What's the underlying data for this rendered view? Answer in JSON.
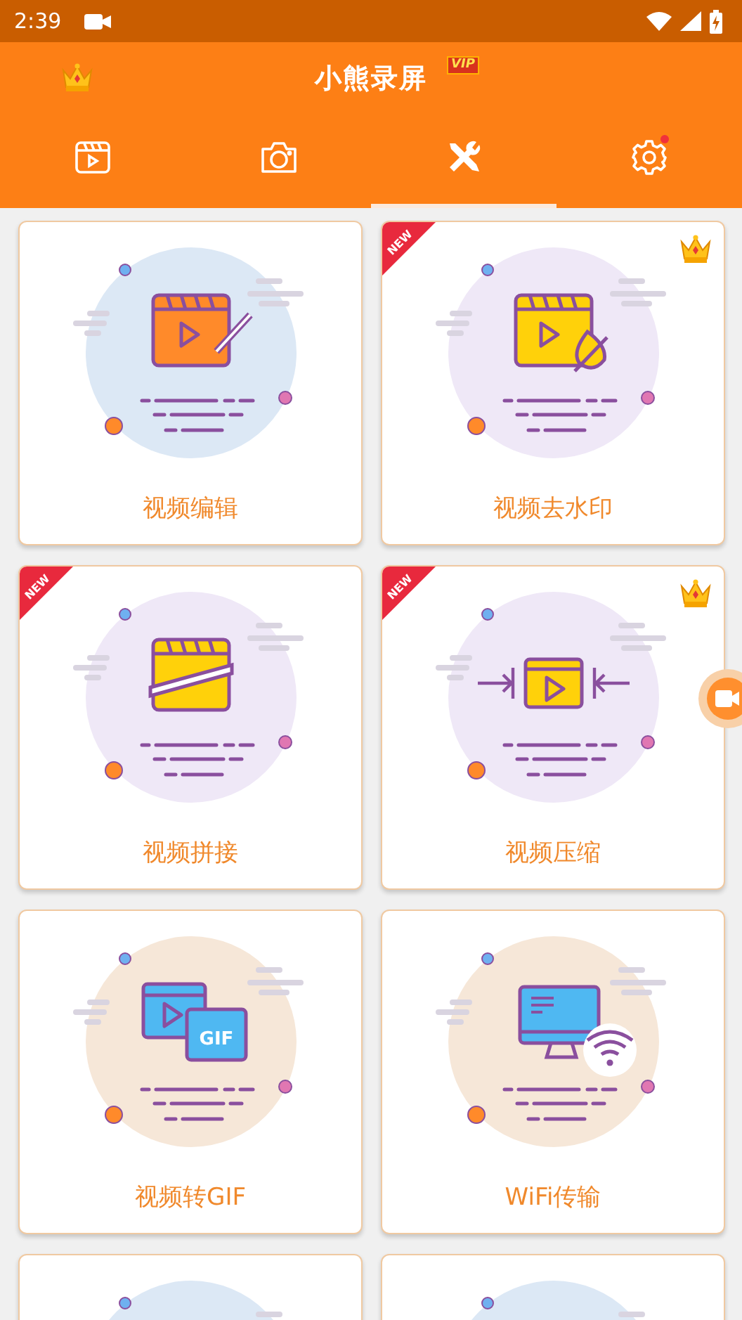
{
  "status_bar": {
    "time": "2:39"
  },
  "header": {
    "title": "小熊录屏",
    "vip_badge": "VIP"
  },
  "tabs": [
    {
      "kind": "clapper",
      "selected": false,
      "dot": false
    },
    {
      "kind": "camera",
      "selected": false,
      "dot": false
    },
    {
      "kind": "tools",
      "selected": true,
      "dot": false
    },
    {
      "kind": "settings",
      "selected": false,
      "dot": true
    }
  ],
  "cards": [
    {
      "kind": "edit",
      "label": "视频编辑",
      "color": "#dce8f5",
      "vip": false
    },
    {
      "kind": "watermark",
      "label": "视频去水印",
      "color": "#efe8f7",
      "new_badge": "NEW",
      "vip": true
    },
    {
      "kind": "splice",
      "label": "视频拼接",
      "color": "#efe8f7",
      "new_badge": "NEW",
      "vip": false
    },
    {
      "kind": "compress",
      "label": "视频压缩",
      "color": "#efe8f7",
      "new_badge": "NEW",
      "vip": true
    },
    {
      "kind": "gif",
      "label": "视频转GIF",
      "icon_text": "GIF",
      "color": "#f6e7d8",
      "vip": false
    },
    {
      "kind": "wifi",
      "label": "WiFi传输",
      "color": "#f6e7d8",
      "vip": false
    },
    {
      "kind": "partial",
      "color": "#dce8f5",
      "vip": false
    },
    {
      "kind": "partial",
      "color": "#dce8f5",
      "vip": false
    }
  ]
}
